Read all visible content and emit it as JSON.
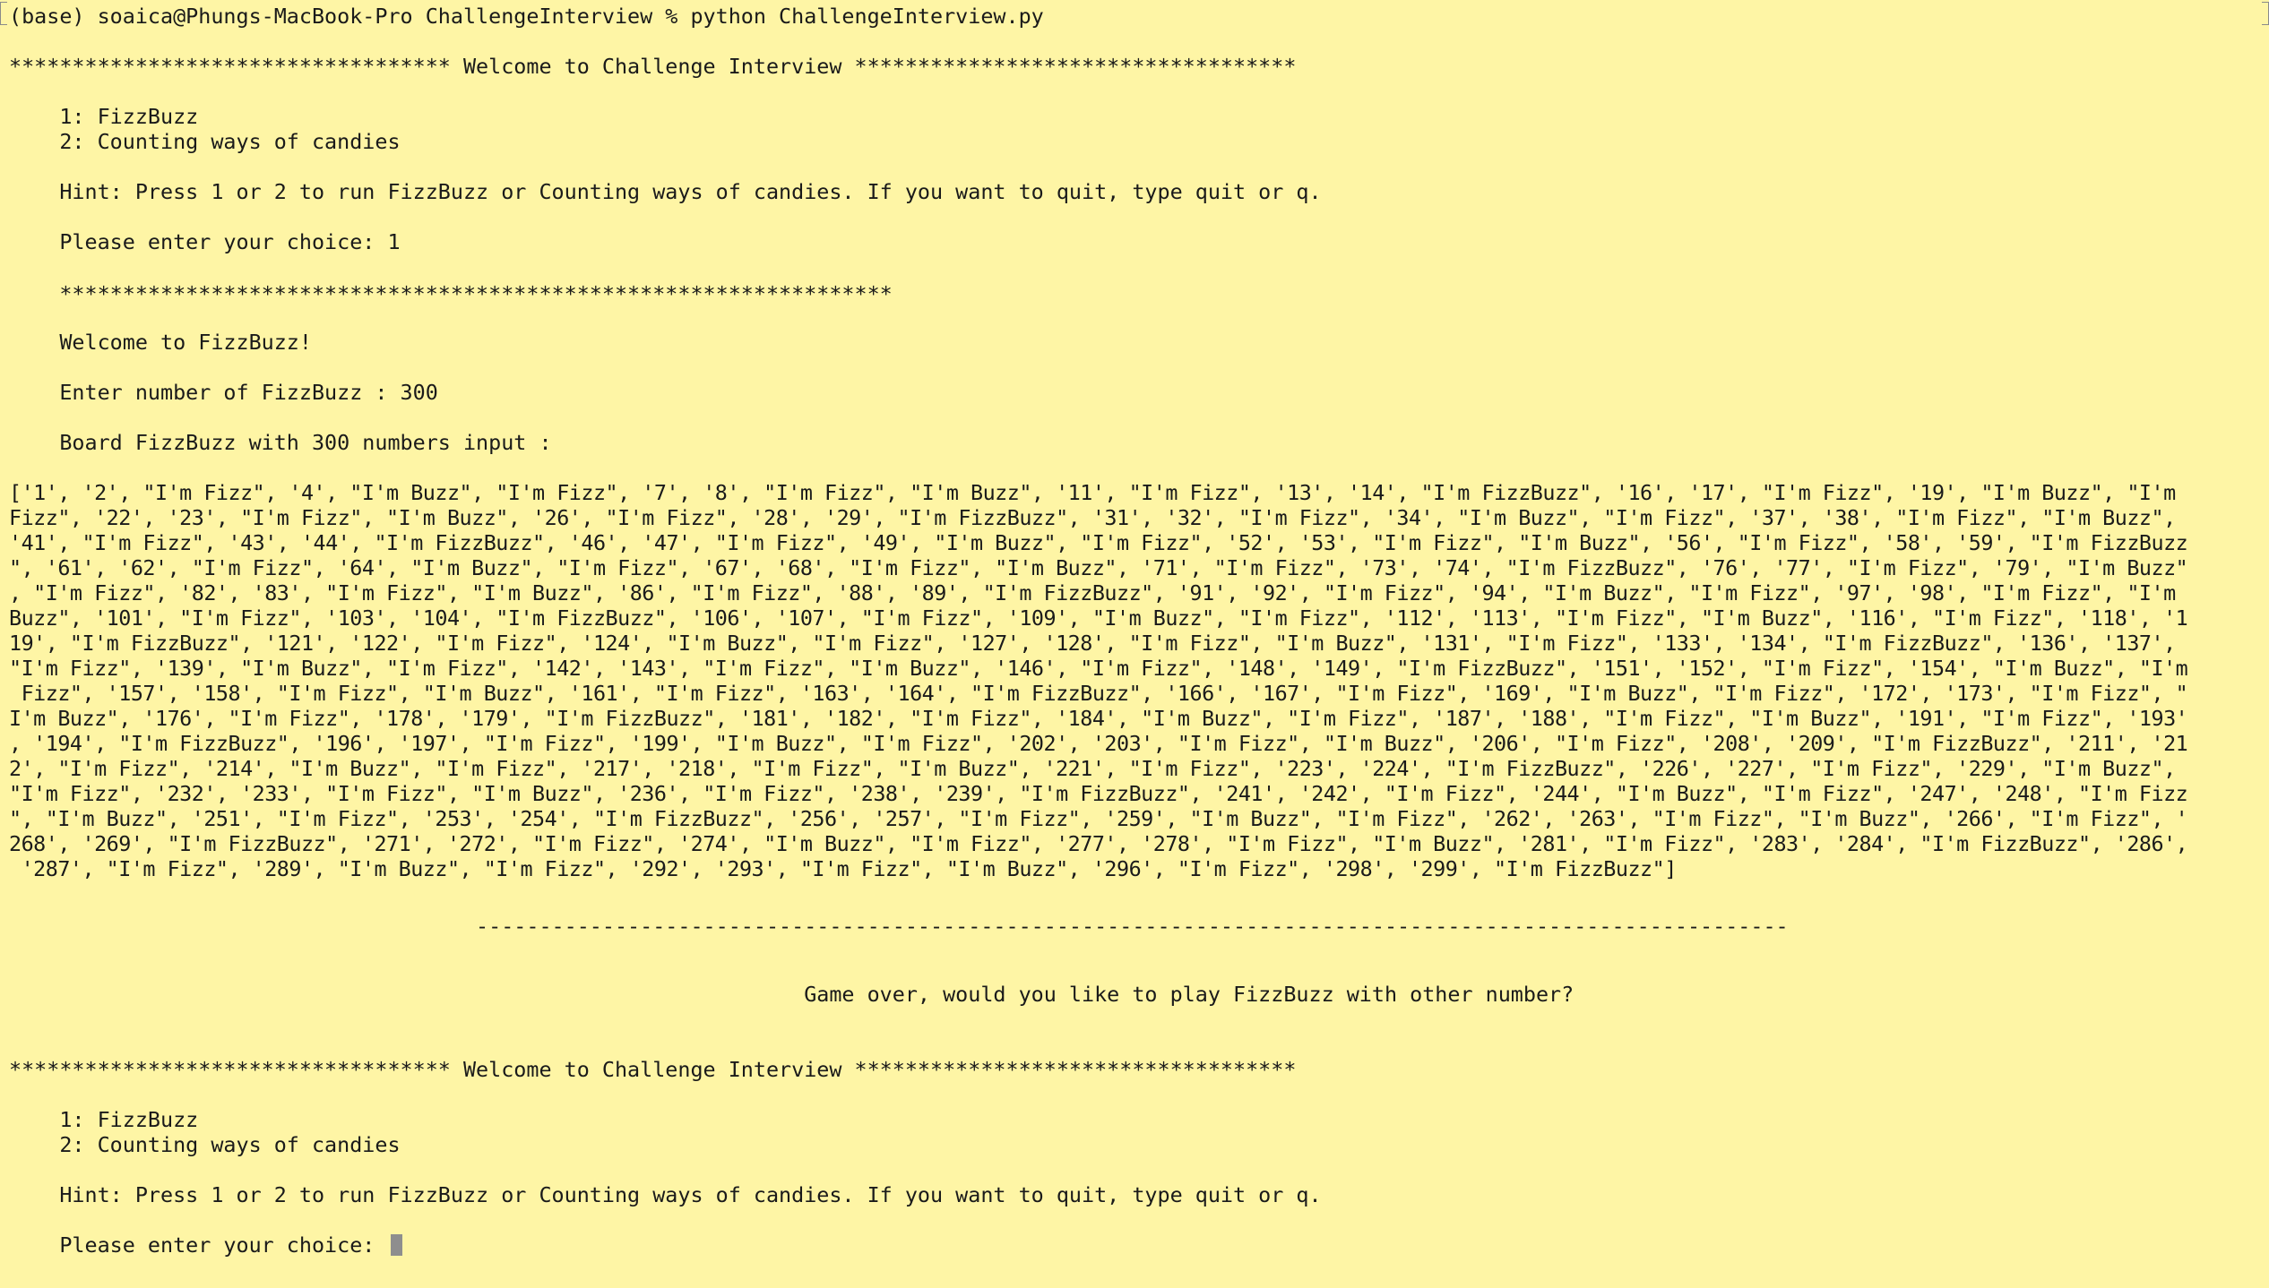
{
  "terminal": {
    "command_line": "(base) soaica@Phungs-MacBook-Pro ChallengeInterview % python ChallengeInterview.py",
    "welcome_banner_1": "*********************************** Welcome to Challenge Interview ***********************************",
    "menu_option_1": "    1: FizzBuzz",
    "menu_option_2": "    2: Counting ways of candies",
    "hint_1": "    Hint: Press 1 or 2 to run FizzBuzz or Counting ways of candies. If you want to quit, type quit or q.",
    "prompt_1": "    Please enter your choice: 1",
    "divider_stars": "    ******************************************************************",
    "welcome_fizzbuzz": "    Welcome to FizzBuzz!",
    "enter_number": "    Enter number of FizzBuzz : 300",
    "board_header": "    Board FizzBuzz with 300 numbers input :",
    "result_lines": [
      "['1', '2', \"I'm Fizz\", '4', \"I'm Buzz\", \"I'm Fizz\", '7', '8', \"I'm Fizz\", \"I'm Buzz\", '11', \"I'm Fizz\", '13', '14', \"I'm FizzBuzz\", '16', '17', \"I'm Fizz\", '19', \"I'm Buzz\", \"I'm",
      "Fizz\", '22', '23', \"I'm Fizz\", \"I'm Buzz\", '26', \"I'm Fizz\", '28', '29', \"I'm FizzBuzz\", '31', '32', \"I'm Fizz\", '34', \"I'm Buzz\", \"I'm Fizz\", '37', '38', \"I'm Fizz\", \"I'm Buzz\",",
      "'41', \"I'm Fizz\", '43', '44', \"I'm FizzBuzz\", '46', '47', \"I'm Fizz\", '49', \"I'm Buzz\", \"I'm Fizz\", '52', '53', \"I'm Fizz\", \"I'm Buzz\", '56', \"I'm Fizz\", '58', '59', \"I'm FizzBuzz",
      "\", '61', '62', \"I'm Fizz\", '64', \"I'm Buzz\", \"I'm Fizz\", '67', '68', \"I'm Fizz\", \"I'm Buzz\", '71', \"I'm Fizz\", '73', '74', \"I'm FizzBuzz\", '76', '77', \"I'm Fizz\", '79', \"I'm Buzz\"",
      ", \"I'm Fizz\", '82', '83', \"I'm Fizz\", \"I'm Buzz\", '86', \"I'm Fizz\", '88', '89', \"I'm FizzBuzz\", '91', '92', \"I'm Fizz\", '94', \"I'm Buzz\", \"I'm Fizz\", '97', '98', \"I'm Fizz\", \"I'm",
      "Buzz\", '101', \"I'm Fizz\", '103', '104', \"I'm FizzBuzz\", '106', '107', \"I'm Fizz\", '109', \"I'm Buzz\", \"I'm Fizz\", '112', '113', \"I'm Fizz\", \"I'm Buzz\", '116', \"I'm Fizz\", '118', '1",
      "19', \"I'm FizzBuzz\", '121', '122', \"I'm Fizz\", '124', \"I'm Buzz\", \"I'm Fizz\", '127', '128', \"I'm Fizz\", \"I'm Buzz\", '131', \"I'm Fizz\", '133', '134', \"I'm FizzBuzz\", '136', '137',",
      "\"I'm Fizz\", '139', \"I'm Buzz\", \"I'm Fizz\", '142', '143', \"I'm Fizz\", \"I'm Buzz\", '146', \"I'm Fizz\", '148', '149', \"I'm FizzBuzz\", '151', '152', \"I'm Fizz\", '154', \"I'm Buzz\", \"I'm",
      " Fizz\", '157', '158', \"I'm Fizz\", \"I'm Buzz\", '161', \"I'm Fizz\", '163', '164', \"I'm FizzBuzz\", '166', '167', \"I'm Fizz\", '169', \"I'm Buzz\", \"I'm Fizz\", '172', '173', \"I'm Fizz\", \"",
      "I'm Buzz\", '176', \"I'm Fizz\", '178', '179', \"I'm FizzBuzz\", '181', '182', \"I'm Fizz\", '184', \"I'm Buzz\", \"I'm Fizz\", '187', '188', \"I'm Fizz\", \"I'm Buzz\", '191', \"I'm Fizz\", '193'",
      ", '194', \"I'm FizzBuzz\", '196', '197', \"I'm Fizz\", '199', \"I'm Buzz\", \"I'm Fizz\", '202', '203', \"I'm Fizz\", \"I'm Buzz\", '206', \"I'm Fizz\", '208', '209', \"I'm FizzBuzz\", '211', '21",
      "2', \"I'm Fizz\", '214', \"I'm Buzz\", \"I'm Fizz\", '217', '218', \"I'm Fizz\", \"I'm Buzz\", '221', \"I'm Fizz\", '223', '224', \"I'm FizzBuzz\", '226', '227', \"I'm Fizz\", '229', \"I'm Buzz\",",
      "\"I'm Fizz\", '232', '233', \"I'm Fizz\", \"I'm Buzz\", '236', \"I'm Fizz\", '238', '239', \"I'm FizzBuzz\", '241', '242', \"I'm Fizz\", '244', \"I'm Buzz\", \"I'm Fizz\", '247', '248', \"I'm Fizz",
      "\", \"I'm Buzz\", '251', \"I'm Fizz\", '253', '254', \"I'm FizzBuzz\", '256', '257', \"I'm Fizz\", '259', \"I'm Buzz\", \"I'm Fizz\", '262', '263', \"I'm Fizz\", \"I'm Buzz\", '266', \"I'm Fizz\", '",
      "268', '269', \"I'm FizzBuzz\", '271', '272', \"I'm Fizz\", '274', \"I'm Buzz\", \"I'm Fizz\", '277', '278', \"I'm Fizz\", \"I'm Buzz\", '281', \"I'm Fizz\", '283', '284', \"I'm FizzBuzz\", '286',",
      " '287', \"I'm Fizz\", '289', \"I'm Buzz\", \"I'm Fizz\", '292', '293', \"I'm Fizz\", \"I'm Buzz\", '296', \"I'm Fizz\", '298', '299', \"I'm FizzBuzz\"]"
    ],
    "dash_divider": "                                     --------------------------------------------------------------------------------------------------------",
    "game_over": "                                                               Game over, would you like to play FizzBuzz with other number?",
    "welcome_banner_2": "*********************************** Welcome to Challenge Interview ***********************************",
    "menu_option_1b": "    1: FizzBuzz",
    "menu_option_2b": "    2: Counting ways of candies",
    "hint_2": "    Hint: Press 1 or 2 to run FizzBuzz or Counting ways of candies. If you want to quit, type quit or q.",
    "prompt_2": "    Please enter your choice: "
  }
}
